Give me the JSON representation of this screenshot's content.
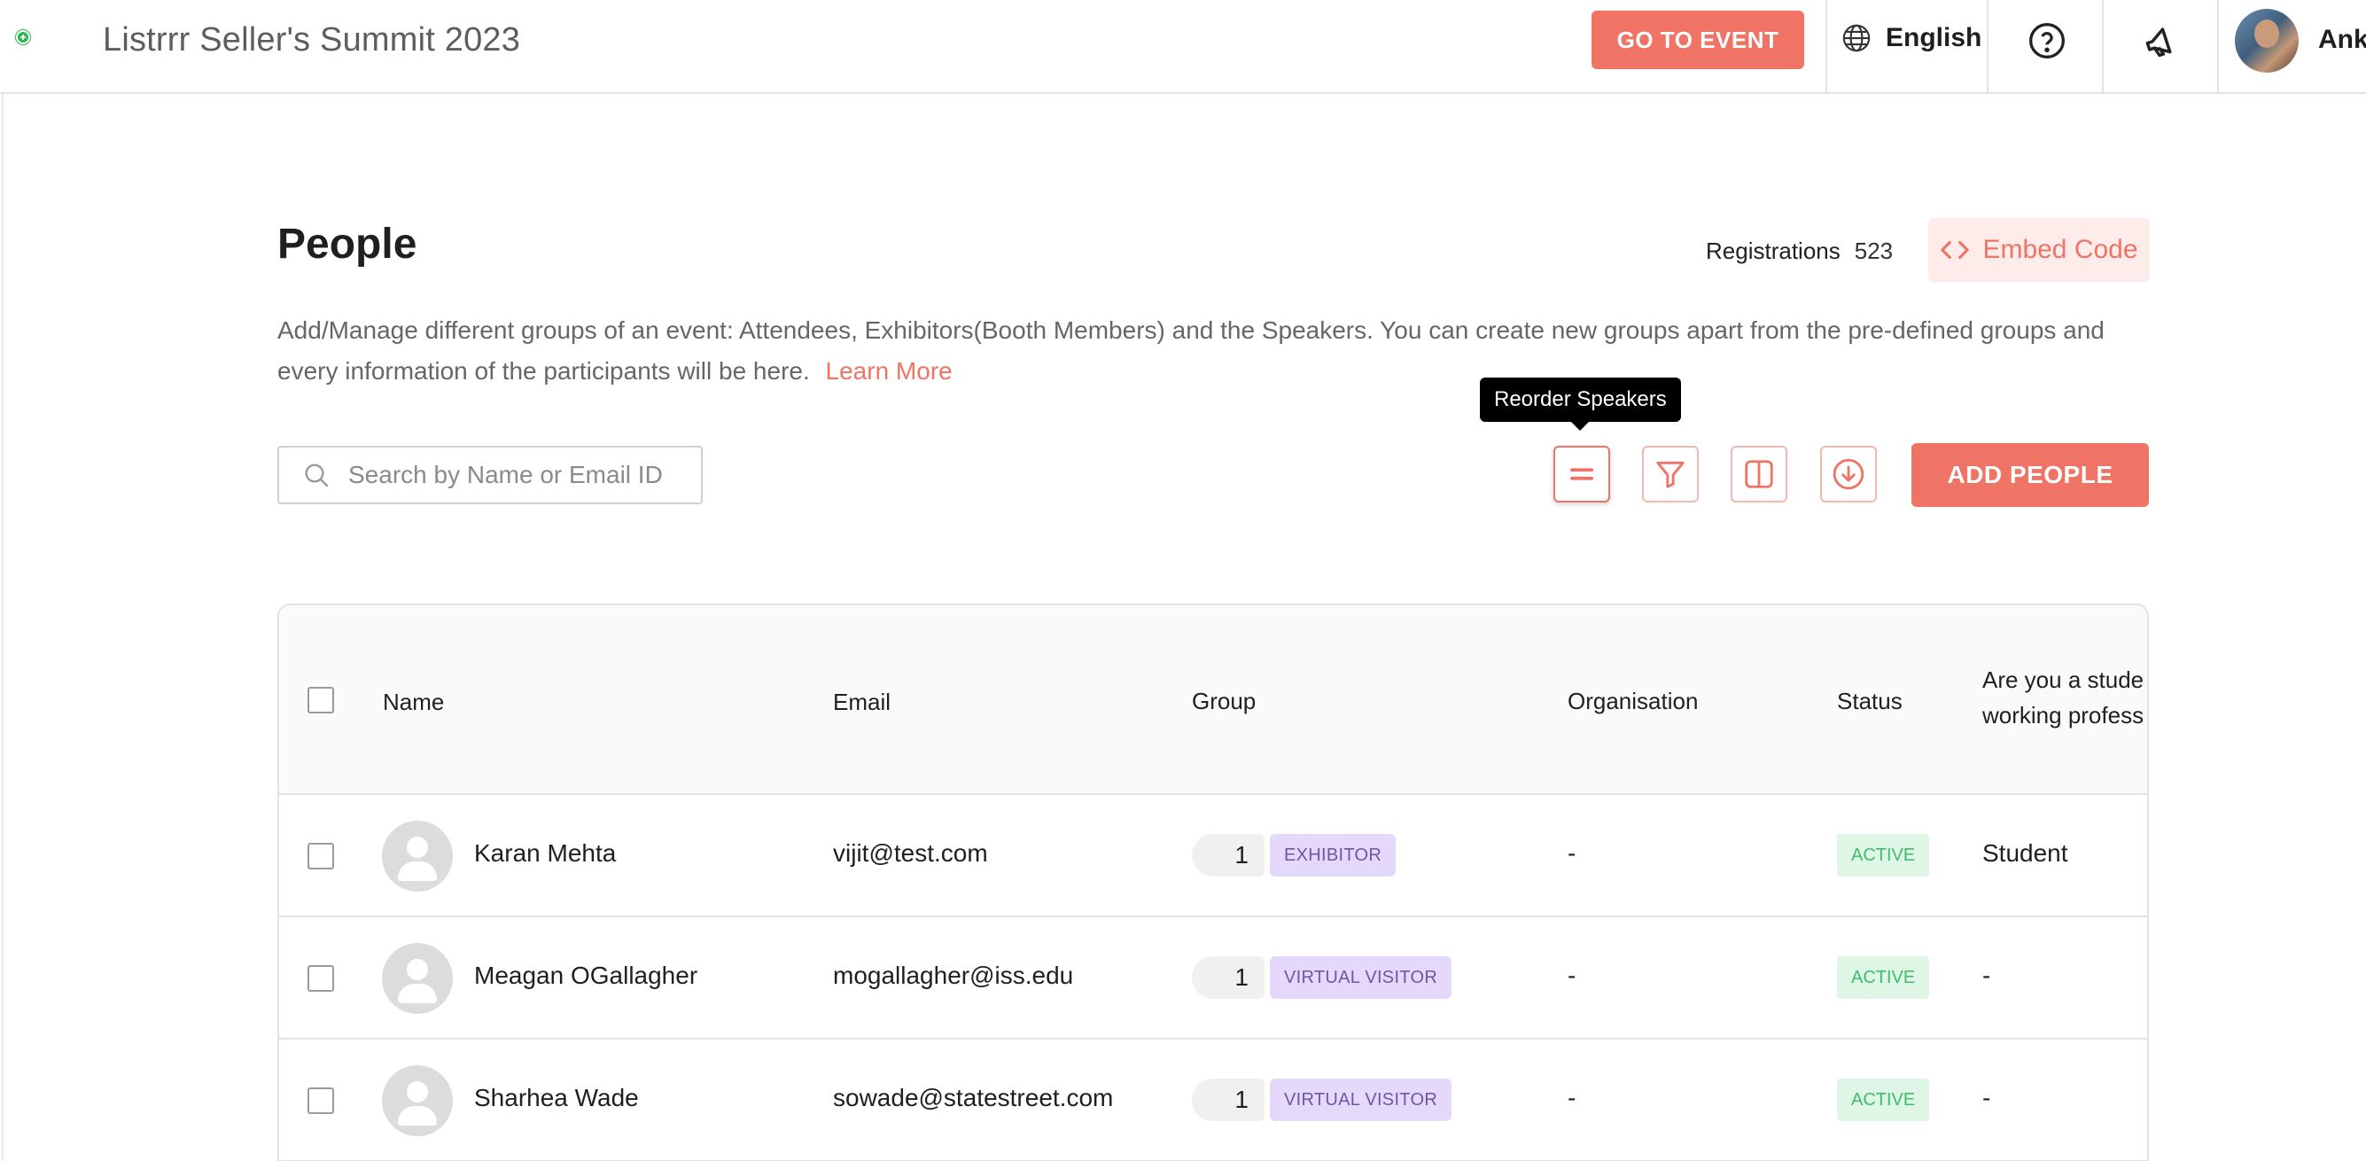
{
  "topbar": {
    "event_title": "Listrrr Seller's Summit 2023",
    "go_to_event": "GO TO EVENT",
    "language": "English",
    "user_name": "Ank"
  },
  "header": {
    "title": "People",
    "registrations_label": "Registrations",
    "registrations_count": "523",
    "embed_code": "Embed Code",
    "description": "Add/Manage different groups of an event: Attendees, Exhibitors(Booth Members) and the Speakers. You can create new groups apart from the pre-defined groups and every information of the participants will be here.",
    "learn_more": "Learn More"
  },
  "toolbar": {
    "search_placeholder": "Search by Name or Email ID",
    "tooltip": "Reorder Speakers",
    "add_people": "ADD PEOPLE"
  },
  "table": {
    "columns": {
      "name": "Name",
      "email": "Email",
      "group": "Group",
      "organisation": "Organisation",
      "status": "Status",
      "student_line1": "Are you a stude",
      "student_line2": "working profess"
    },
    "rows": [
      {
        "name": "Karan Mehta",
        "email": "vijit@test.com",
        "group_count": "1",
        "group": "EXHIBITOR",
        "organisation": "-",
        "status": "ACTIVE",
        "student": "Student"
      },
      {
        "name": "Meagan OGallagher",
        "email": "mogallagher@iss.edu",
        "group_count": "1",
        "group": "VIRTUAL VISITOR",
        "organisation": "-",
        "status": "ACTIVE",
        "student": "-"
      },
      {
        "name": "Sharhea Wade",
        "email": "sowade@statestreet.com",
        "group_count": "1",
        "group": "VIRTUAL VISITOR",
        "organisation": "-",
        "status": "ACTIVE",
        "student": "-"
      }
    ]
  },
  "colors": {
    "accent": "#ef7465",
    "accent_light": "#fdecea",
    "group_tag_bg": "#e4d9fb",
    "group_tag_text": "#6e55a8",
    "status_bg": "#dff5e6",
    "status_text": "#3ebd6a"
  },
  "icons": {
    "status_dot": "online-dot-icon",
    "language": "globe-icon",
    "help": "question-circle-icon",
    "announcements": "megaphone-icon",
    "embed": "code-brackets-icon",
    "search": "search-icon",
    "reorder": "reorder-icon",
    "filter": "filter-icon",
    "columns": "columns-icon",
    "download": "download-icon",
    "avatar_placeholder": "user-avatar-icon"
  }
}
